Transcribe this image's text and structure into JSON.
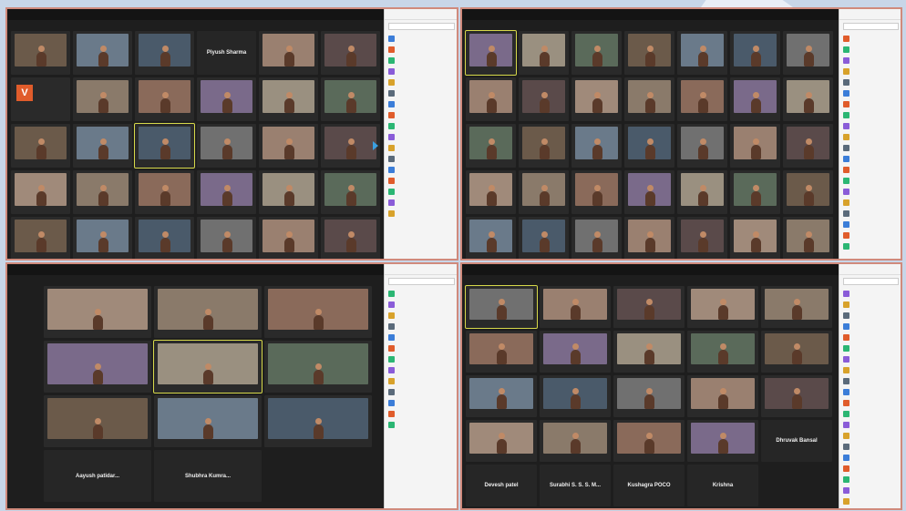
{
  "colors": {
    "highlight": "#d7d94a",
    "border": "#d08a7c",
    "avatar_v": "#e05c2b"
  },
  "quadrants": [
    {
      "cols": 6,
      "tiles": [
        {
          "name": ""
        },
        {
          "name": ""
        },
        {
          "name": ""
        },
        {
          "text": "Piyush Sharma"
        },
        {
          "name": ""
        },
        {
          "name": ""
        },
        {
          "avatar": "V"
        },
        {
          "name": ""
        },
        {
          "name": ""
        },
        {
          "name": ""
        },
        {
          "name": ""
        },
        {
          "name": ""
        },
        {
          "name": ""
        },
        {
          "name": ""
        },
        {
          "name": "",
          "hl": true
        },
        {
          "name": ""
        },
        {
          "name": ""
        },
        {
          "name": ""
        },
        {
          "name": ""
        },
        {
          "name": ""
        },
        {
          "name": ""
        },
        {
          "name": ""
        },
        {
          "name": ""
        },
        {
          "name": ""
        },
        {
          "name": ""
        },
        {
          "name": ""
        },
        {
          "name": ""
        },
        {
          "name": ""
        },
        {
          "name": ""
        },
        {
          "name": ""
        }
      ],
      "participants_title": "",
      "participants": [
        "",
        "",
        "",
        "",
        "",
        "",
        "",
        "",
        "",
        "",
        "",
        "",
        "",
        "",
        "",
        "",
        ""
      ]
    },
    {
      "cols": 7,
      "tiles": [
        {
          "name": "",
          "hl": true
        },
        {
          "name": ""
        },
        {
          "name": ""
        },
        {
          "name": ""
        },
        {
          "name": ""
        },
        {
          "name": ""
        },
        {
          "name": ""
        },
        {
          "name": ""
        },
        {
          "name": ""
        },
        {
          "name": ""
        },
        {
          "name": ""
        },
        {
          "name": ""
        },
        {
          "name": ""
        },
        {
          "name": ""
        },
        {
          "name": ""
        },
        {
          "name": ""
        },
        {
          "name": ""
        },
        {
          "name": ""
        },
        {
          "name": ""
        },
        {
          "name": ""
        },
        {
          "name": ""
        },
        {
          "name": ""
        },
        {
          "name": ""
        },
        {
          "name": ""
        },
        {
          "name": ""
        },
        {
          "name": ""
        },
        {
          "name": ""
        },
        {
          "name": ""
        },
        {
          "name": ""
        },
        {
          "name": ""
        },
        {
          "name": ""
        },
        {
          "name": ""
        },
        {
          "name": ""
        },
        {
          "name": ""
        },
        {
          "name": ""
        }
      ],
      "participants_title": "",
      "participants": [
        "",
        "",
        "",
        "",
        "",
        "",
        "",
        "",
        "",
        "",
        "",
        "",
        "",
        "",
        "",
        "",
        "",
        "",
        "",
        ""
      ]
    },
    {
      "cols": 3,
      "tiles": [
        {
          "name": ""
        },
        {
          "name": ""
        },
        {
          "name": ""
        },
        {
          "name": ""
        },
        {
          "name": "",
          "hl": true
        },
        {
          "name": ""
        },
        {
          "name": ""
        },
        {
          "name": ""
        },
        {
          "name": ""
        },
        {
          "text": "Aayush patidar..."
        },
        {
          "text": "Shubhra Kumra..."
        }
      ],
      "participants_title": "",
      "participants": [
        "",
        "",
        "",
        "",
        "",
        "",
        "",
        "",
        "",
        "",
        "",
        "",
        ""
      ]
    },
    {
      "cols": 5,
      "tiles": [
        {
          "name": "",
          "hl": true
        },
        {
          "name": ""
        },
        {
          "name": ""
        },
        {
          "name": ""
        },
        {
          "name": ""
        },
        {
          "name": ""
        },
        {
          "name": ""
        },
        {
          "name": ""
        },
        {
          "name": ""
        },
        {
          "name": ""
        },
        {
          "name": ""
        },
        {
          "name": ""
        },
        {
          "name": ""
        },
        {
          "name": ""
        },
        {
          "name": ""
        },
        {
          "name": ""
        },
        {
          "name": ""
        },
        {
          "name": ""
        },
        {
          "name": ""
        },
        {
          "text": "Dhruvak Bansal"
        },
        {
          "text": "Devesh patel"
        },
        {
          "text": "Surabhi S. S. S. M..."
        },
        {
          "text": "Kushagra POCO"
        },
        {
          "text": "Krishna"
        }
      ],
      "participants_title": "",
      "participants": [
        "",
        "",
        "",
        "",
        "",
        "",
        "",
        "",
        "",
        "",
        "",
        "",
        "",
        "",
        "",
        "",
        "",
        "",
        "",
        ""
      ]
    }
  ]
}
